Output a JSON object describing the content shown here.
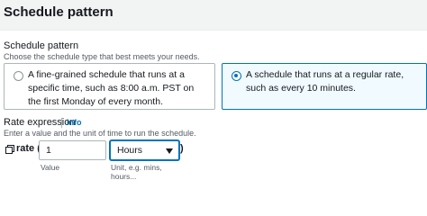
{
  "header": {
    "title": "Schedule pattern"
  },
  "schedule_pattern": {
    "label": "Schedule pattern",
    "description": "Choose the schedule type that best meets your needs.",
    "options": [
      {
        "text": "A fine-grained schedule that runs at a specific time, such as 8:00 a.m. PST on the first Monday of every month.",
        "selected": false
      },
      {
        "text": "A schedule that runs at a regular rate, such as every 10 minutes.",
        "selected": true
      }
    ]
  },
  "rate_expression": {
    "label": "Rate expression",
    "info_link": "Info",
    "description": "Enter a value and the unit of time to run the schedule.",
    "prefix": "rate (",
    "suffix": ")",
    "value": "1",
    "value_hint": "Value",
    "unit": "Hours",
    "unit_hint": "Unit, e.g. mins, hours..."
  },
  "colors": {
    "accent": "#0073bb",
    "header_bg": "#f2f3f3",
    "selected_bg": "#f1faff"
  }
}
